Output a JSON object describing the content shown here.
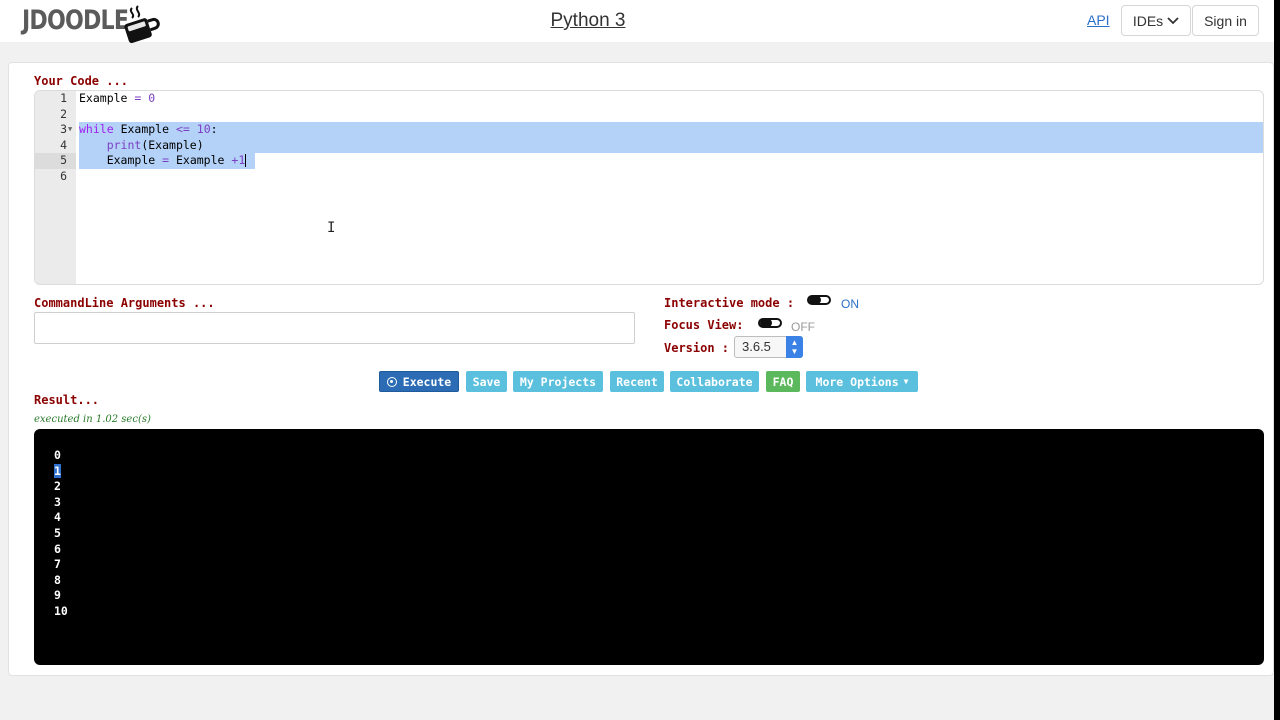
{
  "header": {
    "logo_text": "JDOODLE",
    "title": "Python 3",
    "api_label": "API",
    "ides_label": "IDEs",
    "signin_label": "Sign in"
  },
  "editor": {
    "label": "Your Code ...",
    "line_numbers": [
      "1",
      "2",
      "3",
      "4",
      "5",
      "6"
    ],
    "code": {
      "l1_var": "Example",
      "l1_op": "=",
      "l1_num": "0",
      "l3_kw": "while",
      "l3_var": "Example",
      "l3_op": "<=",
      "l3_num": "10",
      "l3_colon": ":",
      "l4_fn": "print",
      "l4_arg": "(Example)",
      "l5_var": "Example",
      "l5_op": "=",
      "l5_var2": "Example",
      "l5_plus": "+1"
    }
  },
  "cmdline": {
    "label": "CommandLine Arguments ...",
    "value": ""
  },
  "options": {
    "interactive_label": "Interactive mode :",
    "interactive_state": "ON",
    "focus_label": "Focus View:",
    "focus_state": "OFF",
    "version_label": "Version :",
    "version_value": "3.6.5"
  },
  "toolbar": {
    "execute": "Execute",
    "save": "Save",
    "my_projects": "My Projects",
    "recent": "Recent",
    "collaborate": "Collaborate",
    "faq": "FAQ",
    "more_options": "More Options"
  },
  "result": {
    "label": "Result...",
    "exec_time": "executed in 1.02 sec(s)",
    "lines": [
      "0",
      "1",
      "2",
      "3",
      "4",
      "5",
      "6",
      "7",
      "8",
      "9",
      "10"
    ]
  },
  "colors": {
    "label_red": "#8b0000",
    "execute_blue": "#2b6cb5",
    "button_cyan": "#5bc0de",
    "faq_green": "#5cb85c",
    "selection": "#b4d2f8"
  }
}
